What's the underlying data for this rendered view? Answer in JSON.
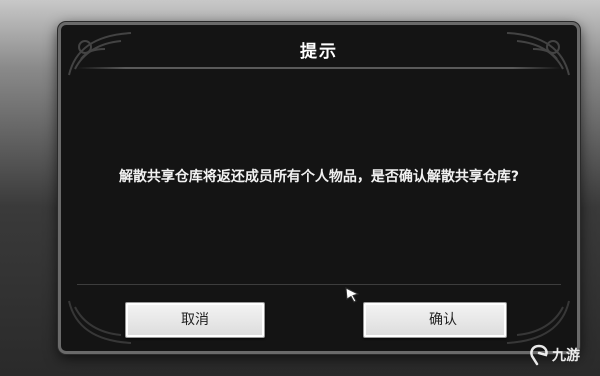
{
  "dialog": {
    "title": "提示",
    "message": "解散共享仓库将返还成员所有个人物品，是否确认解散共享仓库?",
    "cancel_label": "取消",
    "confirm_label": "确认"
  },
  "watermark": {
    "text": "九游"
  },
  "colors": {
    "dialog_background": "#141414",
    "dialog_border": "#6a6a6a",
    "button_face": "#e8e8e8",
    "text_light": "#ffffff"
  },
  "icons": [
    "corner-ornament-icon",
    "pointer-cursor-icon",
    "watermark-logo-icon"
  ]
}
